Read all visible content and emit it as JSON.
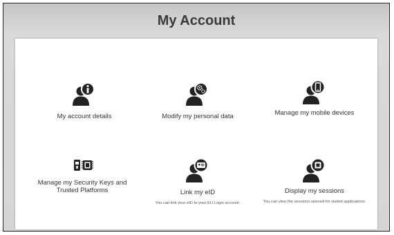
{
  "header": {
    "title": "My Account"
  },
  "tiles": [
    {
      "label": "My account details",
      "icon": "user-info-icon"
    },
    {
      "label": "Modify my personal data",
      "icon": "user-settings-icon"
    },
    {
      "label": "Manage my mobile devices",
      "icon": "user-mobile-icon"
    },
    {
      "label": "Manage my Security Keys and Trusted Platforms",
      "icon": "security-key-icon"
    },
    {
      "label": "Link my eID",
      "description": "You can link your eID to your EU Login account.",
      "icon": "user-eid-icon"
    },
    {
      "label": "Display my sessions",
      "description": "You can view the sessions opened for visited applications.",
      "icon": "user-sessions-icon"
    }
  ],
  "colors": {
    "icon": "#222222",
    "background": "#d4d4d4",
    "panel": "#ffffff"
  }
}
